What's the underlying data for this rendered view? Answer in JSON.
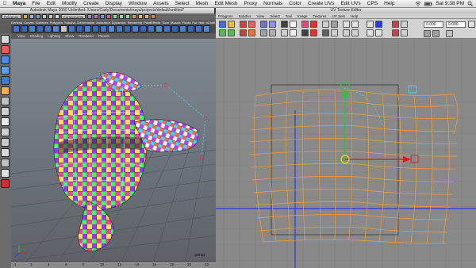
{
  "menubar": {
    "apple": "",
    "app": "Maya",
    "items": [
      "File",
      "Edit",
      "Modify",
      "Create",
      "Display",
      "Window",
      "Assets",
      "Select",
      "Mesh",
      "Edit Mesh",
      "Proxy",
      "Normals",
      "Color",
      "Create UVs",
      "Edit UVs",
      "CPS",
      "Help"
    ],
    "clock": "Sat 9:38 PM"
  },
  "maya_window": {
    "title": "Autodesk Maya 2009 Unlimited: /Users/Cady/Documents/maya/projects/default/untitled*",
    "mode_menu": "Polygons",
    "shelf_tab_components": "Components",
    "shelf_tabs": [
      "General",
      "Curves",
      "Surfaces",
      "Polygons",
      "Subdivs",
      "Deformation",
      "Animation",
      "Dynamics",
      "Rendering",
      "PaintEffects",
      "Toon",
      "Muscle",
      "Fluids",
      "Fur",
      "Hair",
      "nCloth",
      "Custom"
    ],
    "panel_menu": [
      "View",
      "Shading",
      "Lighting",
      "Show",
      "Renderer",
      "Panels"
    ],
    "viewport_label": "persp",
    "timeline_ticks": [
      "1",
      "2",
      "4",
      "6",
      "8",
      "10",
      "12",
      "14",
      "16",
      "18",
      "20",
      "22"
    ]
  },
  "uv_editor": {
    "title": "UV Texture Editor",
    "menu": [
      "Polygons",
      "Subdivs",
      "View",
      "Select",
      "Tool",
      "Image",
      "Textures",
      "UV Sets",
      "Help"
    ],
    "u_value": "0.000",
    "v_value": "0.000"
  },
  "colors": {
    "accent_orange": "#f0a040",
    "manip_green": "#1fcc2a",
    "manip_red": "#e01a1a",
    "manip_blue": "#2a3adb",
    "manip_yellow": "#e8e000",
    "selection_cyan": "#4ad0ff"
  }
}
